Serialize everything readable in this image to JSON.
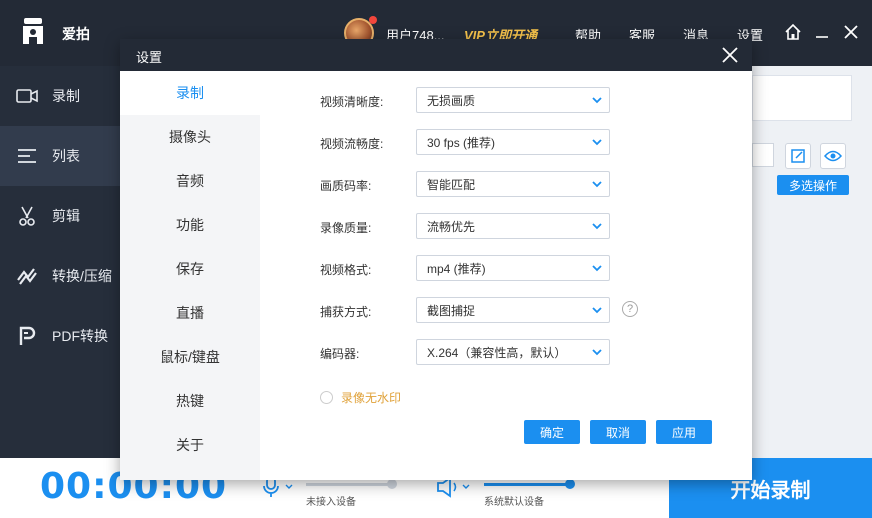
{
  "app": {
    "name": "爱拍"
  },
  "user": {
    "name": "用户748...",
    "vip_label": "VIP立即开通"
  },
  "topnav": {
    "help": "帮助",
    "service": "客服",
    "messages": "消息",
    "settings": "设置"
  },
  "sidebar": {
    "items": [
      {
        "label": "录制",
        "icon": "video-camera-icon"
      },
      {
        "label": "列表",
        "icon": "list-icon"
      },
      {
        "label": "剪辑",
        "icon": "scissors-icon"
      },
      {
        "label": "转换/压缩",
        "icon": "convert-icon"
      },
      {
        "label": "PDF转换",
        "icon": "pdf-icon"
      }
    ],
    "active_index": 1
  },
  "main": {
    "multi_select_label": "多选操作"
  },
  "bottom": {
    "timer": "00:00:00",
    "mic_label": "未接入设备",
    "speaker_label": "系统默认设备",
    "mic_level": 0.95,
    "speaker_level": 1.0,
    "start_label": "开始录制"
  },
  "dialog": {
    "title": "设置",
    "nav": [
      "录制",
      "摄像头",
      "音频",
      "功能",
      "保存",
      "直播",
      "鼠标/键盘",
      "热键",
      "关于"
    ],
    "active_nav_index": 0,
    "fields": [
      {
        "label": "视频清晰度:",
        "value": "无损画质"
      },
      {
        "label": "视频流畅度:",
        "value": "30 fps (推荐)"
      },
      {
        "label": "画质码率:",
        "value": "智能匹配"
      },
      {
        "label": "录像质量:",
        "value": "流畅优先"
      },
      {
        "label": "视频格式:",
        "value": "mp4 (推荐)"
      },
      {
        "label": "捕获方式:",
        "value": "截图捕捉"
      },
      {
        "label": "编码器:",
        "value": "X.264（兼容性高，默认）"
      }
    ],
    "help_symbol": "?",
    "watermark_option": "录像无水印",
    "watermark_checked": false,
    "buttons": {
      "ok": "确定",
      "cancel": "取消",
      "apply": "应用"
    }
  },
  "colors": {
    "accent": "#1b8ff0",
    "titlebar": "#232a36",
    "vip": "#f5c24b",
    "option_text": "#e0a23a"
  }
}
